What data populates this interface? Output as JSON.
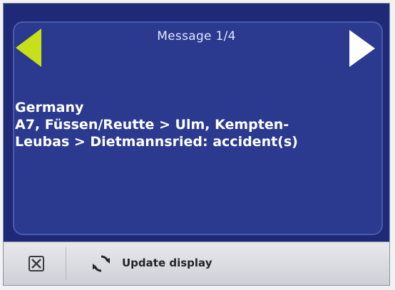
{
  "header": {
    "counter": "Message 1/4"
  },
  "message": {
    "country": "Germany",
    "line1": "A7, Füssen/Reutte > Ulm, Kempten-",
    "line2": "Leubas > Dietmannsried:  accident(s)"
  },
  "toolbar": {
    "update_label": "Update display"
  },
  "icons": {
    "prev": "arrow-left-icon",
    "next": "arrow-right-icon",
    "close": "close-icon",
    "refresh": "refresh-icon"
  },
  "colors": {
    "background": "#1e2a78",
    "panel": "#2b3a8f",
    "prev_arrow": "#c8e01a",
    "next_arrow": "#ffffff",
    "toolbar": "#dcdce2"
  }
}
